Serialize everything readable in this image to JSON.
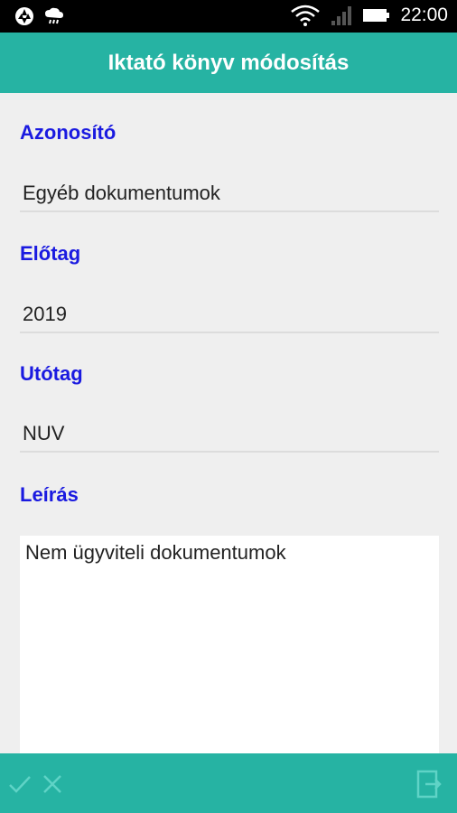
{
  "status_bar": {
    "time": "22:00",
    "icons": [
      "aperture-icon",
      "cloud-icon",
      "wifi-icon",
      "signal-icon",
      "battery-icon"
    ]
  },
  "app_bar": {
    "title": "Iktató könyv módosítás"
  },
  "form": {
    "azonosito": {
      "label": "Azonosító",
      "value": "Egyéb dokumentumok"
    },
    "elotag": {
      "label": "Előtag",
      "value": "2019"
    },
    "utotag": {
      "label": "Utótag",
      "value": "NUV"
    },
    "leiras": {
      "label": "Leírás",
      "value": "Nem ügyviteli dokumentumok"
    }
  },
  "bottom_bar": {
    "icons": [
      "check-icon",
      "close-icon",
      "exit-icon"
    ]
  },
  "colors": {
    "accent": "#26b3a3",
    "label": "#1a1ae0",
    "background": "#efefef"
  }
}
